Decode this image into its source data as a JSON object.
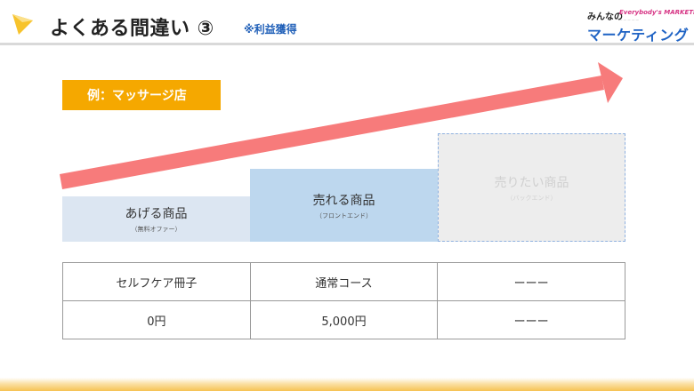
{
  "header": {
    "title": "よくある間違い ③",
    "subtitle": "※利益獲得",
    "brand_top": "みんなの",
    "brand_en": "Everybody's MARKETING",
    "brand_main": "マーケティング"
  },
  "example_label": "例：マッサージ店",
  "products": {
    "give": {
      "name": "あげる商品",
      "note": "（無料オファー）"
    },
    "front": {
      "name": "売れる商品",
      "note": "（フロントエンド）"
    },
    "back": {
      "name": "売りたい商品",
      "note": "（バックエンド）"
    }
  },
  "table": {
    "rows": [
      [
        "セルフケア冊子",
        "通常コース",
        "ーーー"
      ],
      [
        "0円",
        "5,000円",
        "ーーー"
      ]
    ]
  },
  "colors": {
    "accent_orange": "#f5a800",
    "arrow": "#f77b7b",
    "give_fill": "#dce6f2",
    "front_fill": "#bdd7ee",
    "back_fill": "#ededed",
    "subtitle_blue": "#1f5fb8"
  },
  "icons": {
    "logo": "yellow-triangle-icon",
    "arrow": "growth-arrow-icon"
  }
}
